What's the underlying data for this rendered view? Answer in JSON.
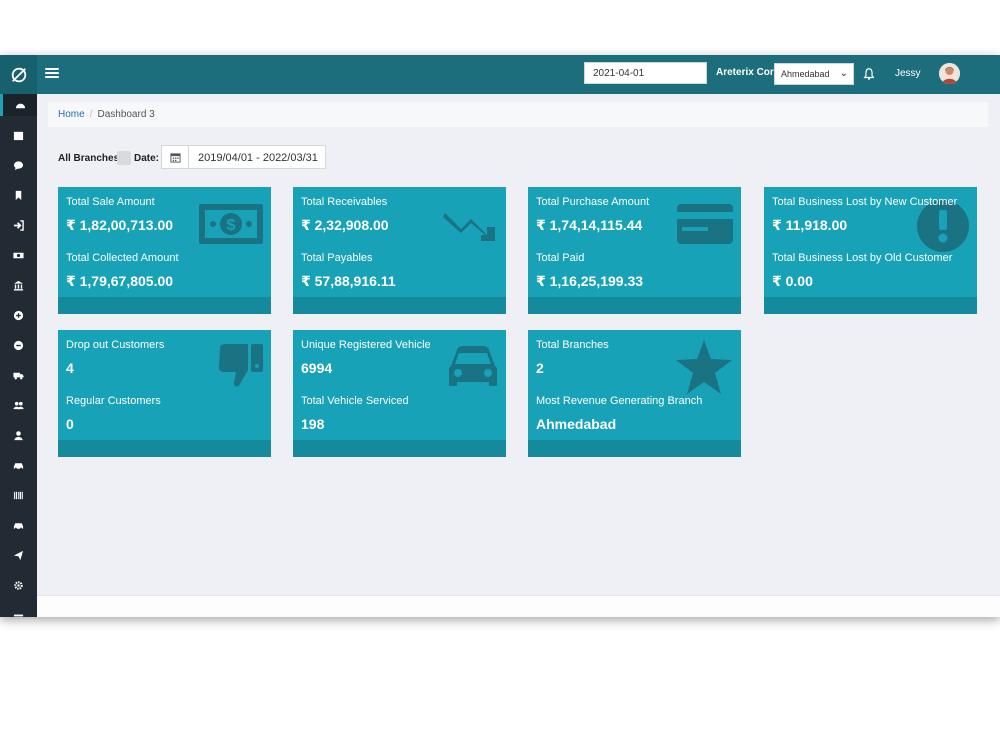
{
  "header": {
    "date_value": "2021-04-01",
    "company": "Areterix Corp",
    "branch_selected": "Ahmedabad",
    "user": "Jessy"
  },
  "sidebar": {
    "items": [
      "dashboard-icon",
      "calendar-icon",
      "chat-icon",
      "bookmark-icon",
      "sign-in-icon",
      "money-icon",
      "bank-icon",
      "plus-circle-icon",
      "minus-circle-icon",
      "truck-icon",
      "users-icon",
      "user-icon",
      "car-icon",
      "barcode-icon",
      "car-alt-icon",
      "send-icon",
      "gear-icon",
      "more-icon"
    ]
  },
  "breadcrumb": {
    "home": "Home",
    "separator": "/",
    "current": "Dashboard 3"
  },
  "filters": {
    "all_branches": "All Branches",
    "date_label": "Date:",
    "date_range": "2019/04/01 - 2022/03/31"
  },
  "colors": {
    "topbar": "#1d6e7c",
    "card": "#17a2b8",
    "card_footer": "#148a9c",
    "sidebar": "#222b33"
  },
  "cards": [
    {
      "label1": "Total Sale Amount",
      "value1": "₹ 1,82,00,713.00",
      "label2": "Total Collected Amount",
      "value2": "₹ 1,79,67,805.00",
      "icon": "money-bill-icon"
    },
    {
      "label1": "Total Receivables",
      "value1": "₹ 2,32,908.00",
      "label2": "Total Payables",
      "value2": "₹ 57,88,916.11",
      "icon": "trend-down-icon"
    },
    {
      "label1": "Total Purchase Amount",
      "value1": "₹ 1,74,14,115.44",
      "label2": "Total Paid",
      "value2": "₹ 1,16,25,199.33",
      "icon": "credit-card-icon"
    },
    {
      "label1": "Total Business Lost by New Customer",
      "value1": "₹ 11,918.00",
      "label2": "Total Business Lost by Old Customer",
      "value2": "₹ 0.00",
      "icon": "exclamation-circle-icon"
    },
    {
      "label1": "Drop out Customers",
      "value1": "4",
      "label2": "Regular Customers",
      "value2": "0",
      "icon": "thumbs-down-icon"
    },
    {
      "label1": "Unique Registered Vehicle",
      "value1": "6994",
      "label2": "Total Vehicle Serviced",
      "value2": "198",
      "icon": "car-icon"
    },
    {
      "label1": "Total Branches",
      "value1": "2",
      "label2": "Most Revenue Generating Branch",
      "value2": "Ahmedabad",
      "icon": "star-icon"
    }
  ]
}
